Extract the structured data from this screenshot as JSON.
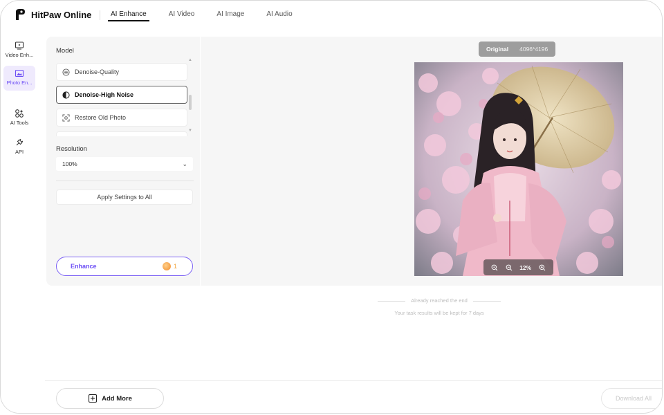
{
  "app": {
    "name": "HitPaw Online"
  },
  "topnav": {
    "tabs": [
      {
        "label": "AI Enhance",
        "active": true
      },
      {
        "label": "AI Video",
        "active": false
      },
      {
        "label": "AI Image",
        "active": false
      },
      {
        "label": "AI Audio",
        "active": false
      }
    ]
  },
  "rail": {
    "items": [
      {
        "label": "Video Enh...",
        "icon": "video-enhance-icon"
      },
      {
        "label": "Photo En...",
        "icon": "photo-enhance-icon",
        "active": true
      },
      {
        "label": "AI Tools",
        "icon": "ai-tools-icon"
      },
      {
        "label": "API",
        "icon": "api-icon"
      }
    ]
  },
  "panel": {
    "model_label": "Model",
    "models": [
      {
        "label": "Denoise-Quality",
        "icon": "denoise-quality-icon"
      },
      {
        "label": "Denoise-High Noise",
        "icon": "denoise-high-noise-icon",
        "selected": true
      },
      {
        "label": "Restore Old Photo",
        "icon": "restore-photo-icon"
      }
    ],
    "resolution_label": "Resolution",
    "resolution_value": "100%",
    "apply_label": "Apply Settings to All",
    "enhance_label": "Enhance",
    "enhance_cost": "1"
  },
  "preview": {
    "badge_label": "Original",
    "dimensions": "4096*4196",
    "zoom": "12%"
  },
  "notes": {
    "end": "Already reached the end",
    "retention": "Your task results will be kept for 7 days"
  },
  "bottom": {
    "add_more": "Add More",
    "download_all": "Download All"
  },
  "colors": {
    "accent": "#6c4ef5",
    "coin": "#f08a2a"
  }
}
